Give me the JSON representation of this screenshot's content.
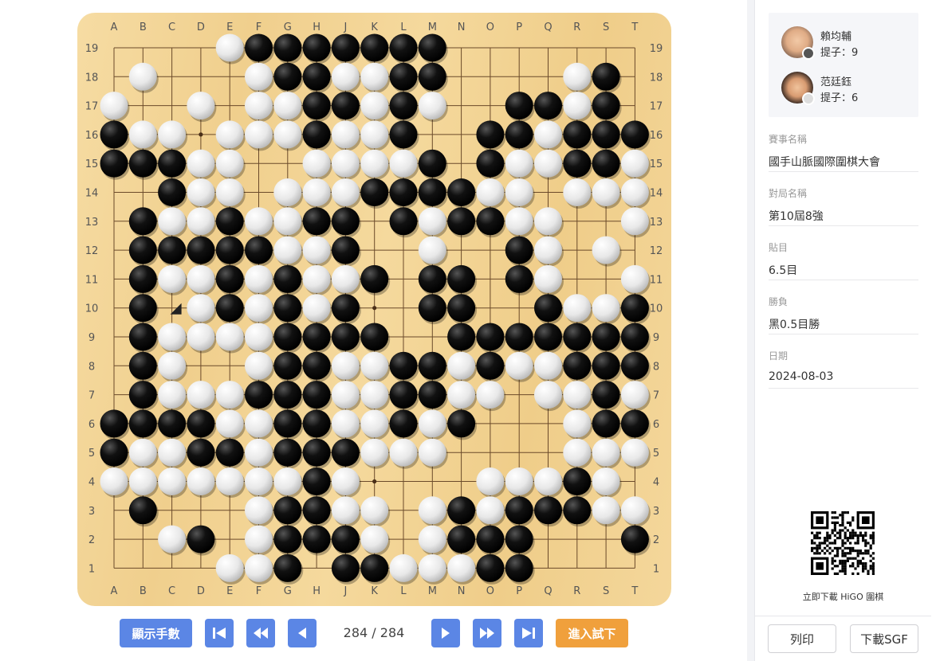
{
  "board": {
    "size": 19,
    "columns": [
      "A",
      "B",
      "C",
      "D",
      "E",
      "F",
      "G",
      "H",
      "J",
      "K",
      "L",
      "M",
      "N",
      "O",
      "P",
      "Q",
      "R",
      "S",
      "T"
    ],
    "rows_top_to_bottom": [
      "....WBBBBBBB.......",
      ".W...WBBWWBB....WB.",
      "W..W.WWBBWBW..BBWB.",
      "BWW.WWWBWWB..BBWBBB",
      "BBBWW..WWWWB.BWWBBW",
      "..BWW.WWWBBBBWW.WWW",
      ".BWWBWWBB.BWBBWW..W",
      ".BBBBBWWB..W..BW.W.",
      ".BWWBWBWWB.BB.BW..W",
      ".B.WBWBWB..BB..BWWB",
      ".BWWWWBBBB..BBBBBBB",
      ".BW..WBBWWBBWBWWBBB",
      ".BWWWBBBWWBBWW.WWBW",
      "BBBBWWBBWWBWB...WBBW",
      "BWWBBWBBBWWW....WWWW",
      "WWWWWWWBW....WWWBW.W",
      ".B...WBBWW.WBWBBBWW",
      "..WB.WBBBW.WBBB...BB",
      "....WWB.BBWWWBB...."
    ],
    "last_move": "C10",
    "last_move_color": "W"
  },
  "controls": {
    "show_numbers": "顯示手數",
    "first_icon": "first-move-icon",
    "prev10_icon": "rewind-icon",
    "prev_icon": "prev-icon",
    "move_counter": "284 / 284",
    "next_icon": "next-icon",
    "next10_icon": "fast-forward-icon",
    "last_icon": "last-move-icon",
    "try_play": "進入試下"
  },
  "players": [
    {
      "name": "賴均輔",
      "captures": "提子：9",
      "color": "black"
    },
    {
      "name": "范廷鈺",
      "captures": "提子：6",
      "color": "white"
    }
  ],
  "info": [
    {
      "label": "賽事名稱",
      "value": "國手山脈國際圍棋大會"
    },
    {
      "label": "對局名稱",
      "value": "第10屆8強"
    },
    {
      "label": "貼目",
      "value": "6.5目"
    },
    {
      "label": "勝負",
      "value": "黑0.5目勝"
    },
    {
      "label": "日期",
      "value": "2024-08-03"
    }
  ],
  "qr_caption": "立即下載 HiGO 圍棋",
  "buttons": {
    "print": "列印",
    "download": "下載SGF"
  },
  "colors": {
    "accent_blue": "#5b86e5",
    "accent_orange": "#f0a03c",
    "board": "#f3d597"
  }
}
